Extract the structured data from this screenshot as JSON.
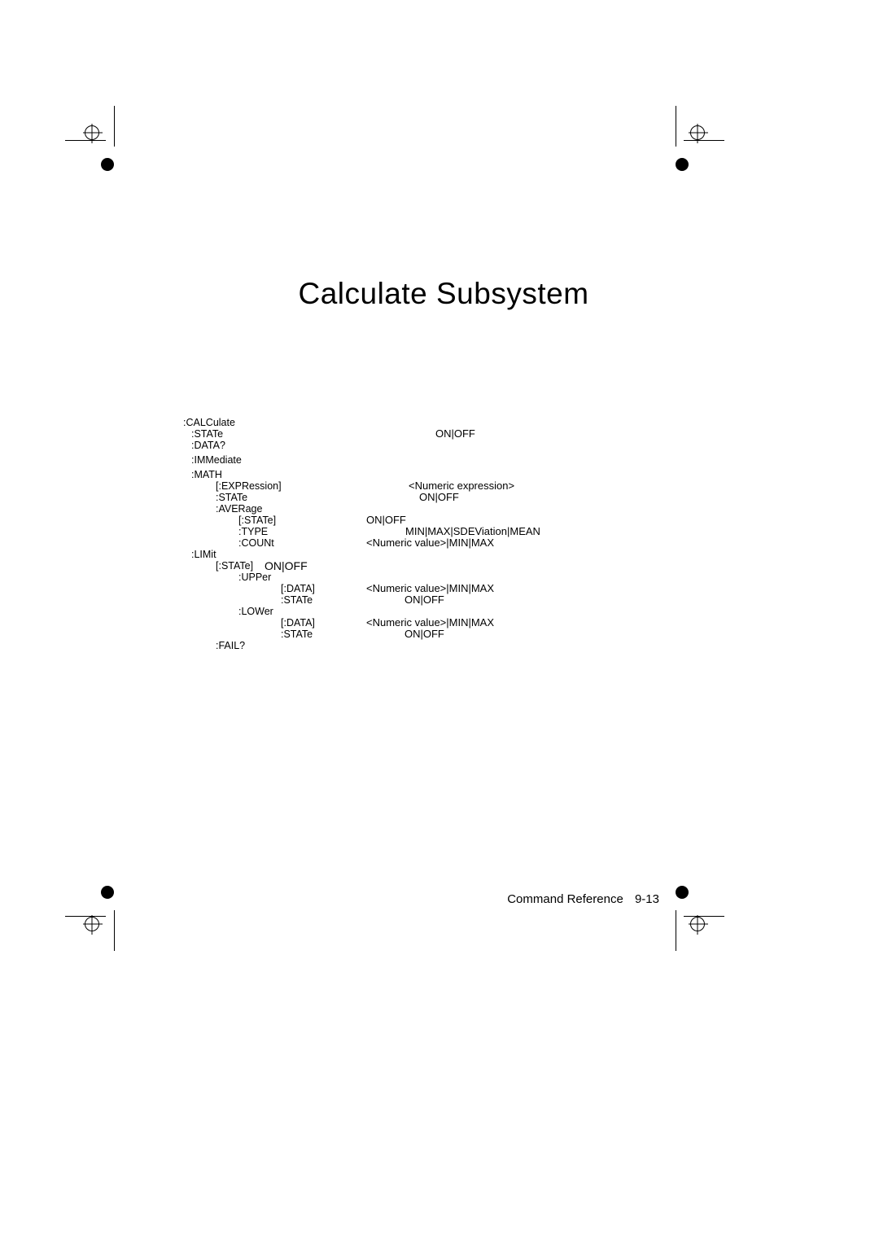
{
  "title": "Calculate Subsystem",
  "tree": {
    "root": ":CALCulate",
    "state": ":STATe",
    "state_val": "ON|OFF",
    "data": ":DATA?",
    "immediate": ":IMMediate",
    "math": ":MATH",
    "expression": "[:EXPRession]",
    "expression_val": "<Numeric expression>",
    "math_state": ":STATe",
    "math_state_val": "ON|OFF",
    "average": ":AVERage",
    "avg_state": "[:STATe]",
    "avg_state_val": "ON|OFF",
    "avg_type": ":TYPE",
    "avg_type_val": "MIN|MAX|SDEViation|MEAN",
    "avg_count": ":COUNt",
    "avg_count_val": "<Numeric value>|MIN|MAX",
    "limit": ":LIMit",
    "limit_state": "[:STATe]",
    "limit_state_val": "ON|OFF",
    "upper": ":UPPer",
    "upper_data": "[:DATA]",
    "upper_data_val": "<Numeric value>|MIN|MAX",
    "upper_state": ":STATe",
    "upper_state_val": "ON|OFF",
    "lower": ":LOWer",
    "lower_data": "[:DATA]",
    "lower_data_val": "<Numeric value>|MIN|MAX",
    "lower_state": ":STATe",
    "lower_state_val": "ON|OFF",
    "fail": ":FAIL?"
  },
  "footer": {
    "label": "Command Reference",
    "page": "9-13"
  }
}
